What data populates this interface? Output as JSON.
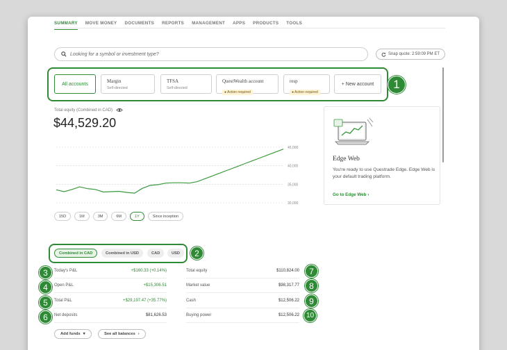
{
  "nav": {
    "items": [
      "SUMMARY",
      "MOVE MONEY",
      "DOCUMENTS",
      "REPORTS",
      "MANAGEMENT",
      "APPS",
      "PRODUCTS",
      "TOOLS"
    ]
  },
  "search": {
    "placeholder": "Looking for a symbol or investment type?",
    "icon": "search-icon"
  },
  "snap_quote": {
    "label": "Snap quote: 2:59:09 PM ET",
    "icon": "refresh-icon"
  },
  "accounts": [
    {
      "name": "All accounts",
      "sub": "",
      "badge": ""
    },
    {
      "name": "Margin",
      "sub": "Self-directed",
      "badge": ""
    },
    {
      "name": "TFSA",
      "sub": "Self-directed",
      "badge": ""
    },
    {
      "name": "QuestWealth account",
      "sub": "",
      "badge": "Action required"
    },
    {
      "name": "resp",
      "sub": "",
      "badge": "Action required"
    },
    {
      "name": "+ New account",
      "sub": "",
      "badge": ""
    }
  ],
  "callouts": [
    "1",
    "2",
    "3",
    "4",
    "5",
    "6",
    "7",
    "8",
    "9",
    "10"
  ],
  "equity": {
    "label": "Total equity (Combined in CAD)",
    "value": "$44,529.20",
    "icon": "eye-icon"
  },
  "chart_data": {
    "type": "line",
    "yticks": [
      "45,000",
      "40,000",
      "35,000",
      "30,000"
    ],
    "ylim": [
      30000,
      45000
    ],
    "series": [
      {
        "values": [
          33500,
          33000,
          33600,
          34300,
          33800,
          33600,
          32900,
          33000,
          33100,
          32800,
          32600,
          33900,
          34700,
          34900,
          35300,
          35400,
          35400,
          35300,
          35700,
          36500,
          37300,
          38100,
          38900,
          39700,
          40500,
          41300,
          42100,
          42900,
          43700,
          44500
        ]
      }
    ],
    "color": "#3a9a3f",
    "grid": true
  },
  "ranges": [
    "15D",
    "1M",
    "3M",
    "6M",
    "1Y",
    "Since inception"
  ],
  "active_range": "1Y",
  "edge": {
    "title": "Edge Web",
    "desc": "You're ready to use Questrade Edge. Edge Web is your default trading platform.",
    "link": "Go to Edge Web  ›",
    "illustration": "laptop-chart-illustration"
  },
  "currency": [
    "Combined in CAD",
    "Combined in USD",
    "CAD",
    "USD"
  ],
  "left_rows": [
    {
      "label": "Today's P&L",
      "value": "+$160.33 (+0.14%)"
    },
    {
      "label": "Open P&L",
      "value": "+$15,306.51"
    },
    {
      "label": "Total P&L",
      "value": "+$29,197.47 (+35.77%)"
    },
    {
      "label": "Net deposits",
      "value": "$81,626.53"
    }
  ],
  "right_rows": [
    {
      "label": "Total equity",
      "value": "$110,824.00"
    },
    {
      "label": "Market value",
      "value": "$98,317.77"
    },
    {
      "label": "Cash",
      "value": "$12,506.22"
    },
    {
      "label": "Buying power",
      "value": "$12,506.22"
    }
  ],
  "buttons": {
    "add_funds": "Add funds",
    "see_balances": "See all balances"
  },
  "colors": {
    "accent": "#2f8a36",
    "warn_bg": "#fff3d4"
  }
}
